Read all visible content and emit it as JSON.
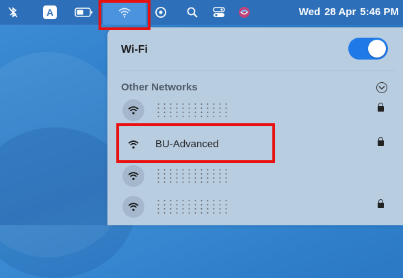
{
  "menubar": {
    "items": [
      "bluetooth-off-icon",
      "input-source-icon",
      "battery-icon",
      "wifi-icon",
      "screen-mirroring-icon",
      "spotlight-icon",
      "control-center-icon",
      "siri-icon"
    ],
    "input_source_letter": "A",
    "day": "Wed",
    "date": "28 Apr",
    "time": "5:46 PM"
  },
  "wifi_menu": {
    "title": "Wi-Fi",
    "enabled": true,
    "section_label": "Other Networks",
    "networks": [
      {
        "name": "",
        "obscured": true,
        "locked": true
      },
      {
        "name": "BU-Advanced",
        "obscured": false,
        "locked": true
      },
      {
        "name": "",
        "obscured": true,
        "locked": false
      },
      {
        "name": "",
        "obscured": true,
        "locked": true
      }
    ]
  },
  "colors": {
    "highlight_box": "#e8110f",
    "toggle_on": "#1f7ae8",
    "menubar": "#2d6fb8"
  }
}
